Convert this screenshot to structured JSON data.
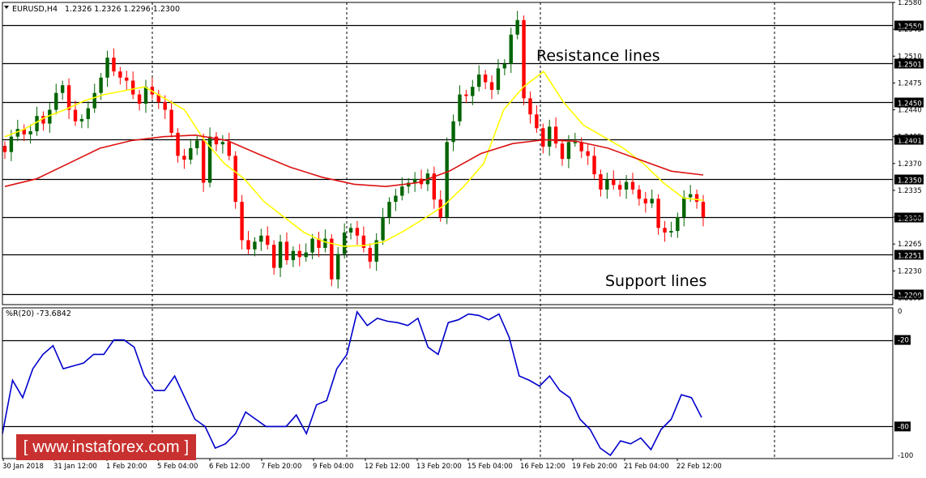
{
  "header": {
    "symbol": "EURUSD,H4",
    "ohlc": "1.2326 1.2326 1.2296 1.2300",
    "indicator": "%R(20) -73.6842"
  },
  "annotations": {
    "resistance": "Resistance lines",
    "support": "Support lines"
  },
  "watermark": "[ www.instaforex.com ]",
  "colors": {
    "bull": "#006400",
    "bear": "#ff0000",
    "ma_fast": "#ffff00",
    "ma_slow": "#dd1111",
    "wpr": "#0000cc",
    "watermark_bg": "#c8312f"
  },
  "chart_data": [
    {
      "type": "candlestick",
      "title": "EURUSD,H4",
      "ylim": [
        1.2186,
        1.258
      ],
      "y_ticks": [
        "1.2580",
        "1.2545",
        "1.2510",
        "1.2475",
        "1.2440",
        "1.2405",
        "1.2370",
        "1.2335",
        "1.2300",
        "1.2265",
        "1.2230",
        "1.2195"
      ],
      "levels": [
        {
          "label": "1.2550",
          "role": "resistance"
        },
        {
          "label": "1.2501",
          "role": "resistance"
        },
        {
          "label": "1.2450",
          "role": "resistance"
        },
        {
          "label": "1.2401",
          "role": "resistance"
        },
        {
          "label": "1.2350",
          "role": "resistance"
        },
        {
          "label": "1.2300",
          "role": "support"
        },
        {
          "label": "1.2251",
          "role": "support"
        },
        {
          "label": "1.2200",
          "role": "support"
        }
      ],
      "x_labels": [
        "30 Jan 2018",
        "31 Jan 12:00",
        "1 Feb 20:00",
        "5 Feb 04:00",
        "6 Feb 12:00",
        "7 Feb 20:00",
        "9 Feb 04:00",
        "12 Feb 12:00",
        "13 Feb 20:00",
        "15 Feb 04:00",
        "16 Feb 12:00",
        "19 Feb 20:00",
        "21 Feb 04:00",
        "22 Feb 12:00"
      ],
      "close": [
        1.2385,
        1.2405,
        1.2415,
        1.2408,
        1.2412,
        1.2432,
        1.2422,
        1.244,
        1.2462,
        1.2472,
        1.244,
        1.2425,
        1.2428,
        1.2442,
        1.2462,
        1.2482,
        1.2508,
        1.249,
        1.2482,
        1.2478,
        1.246,
        1.2448,
        1.247,
        1.246,
        1.245,
        1.244,
        1.241,
        1.238,
        1.2375,
        1.239,
        1.24,
        1.2345,
        1.2405,
        1.2395,
        1.2398,
        1.238,
        1.232,
        1.227,
        1.2258,
        1.2268,
        1.2276,
        1.2264,
        1.2234,
        1.2268,
        1.2244,
        1.2256,
        1.2248,
        1.2254,
        1.2272,
        1.226,
        1.2272,
        1.2219,
        1.2252,
        1.228,
        1.2286,
        1.2276,
        1.226,
        1.2242,
        1.227,
        1.23,
        1.232,
        1.2328,
        1.234,
        1.2345,
        1.235,
        1.2343,
        1.2357,
        1.2323,
        1.23,
        1.2398,
        1.2425,
        1.246,
        1.2458,
        1.247,
        1.2486,
        1.2476,
        1.2466,
        1.2494,
        1.25,
        1.2538,
        1.2557,
        1.2455,
        1.2434,
        1.2416,
        1.2392,
        1.2418,
        1.2396,
        1.2376,
        1.2398,
        1.2398,
        1.2386,
        1.238,
        1.2356,
        1.2336,
        1.2349,
        1.2342,
        1.2336,
        1.2346,
        1.2336,
        1.2324,
        1.2318,
        1.2324,
        1.2286,
        1.228,
        1.2282,
        1.23,
        1.2326,
        1.233,
        1.232,
        1.23
      ],
      "series": [
        {
          "name": "",
          "kind": "moving-average-fast",
          "values": [
            1.2405,
            1.2415,
            1.243,
            1.244,
            1.2452,
            1.246,
            1.2465,
            1.247,
            1.2455,
            1.244,
            1.24,
            1.237,
            1.235,
            1.232,
            1.23,
            1.228,
            1.2268,
            1.2262,
            1.2263,
            1.2268,
            1.2282,
            1.2298,
            1.2315,
            1.234,
            1.237,
            1.244,
            1.247,
            1.249,
            1.245,
            1.242,
            1.2405,
            1.239,
            1.237,
            1.2345,
            1.2325,
            1.2322
          ]
        },
        {
          "name": "",
          "kind": "moving-average-slow",
          "values": [
            1.234,
            1.235,
            1.237,
            1.239,
            1.24,
            1.2405,
            1.2407,
            1.24,
            1.2382,
            1.2365,
            1.2352,
            1.2343,
            1.234,
            1.2345,
            1.236,
            1.2383,
            1.2396,
            1.2401,
            1.2399,
            1.239,
            1.2375,
            1.236,
            1.2355
          ]
        }
      ]
    },
    {
      "type": "line",
      "title": "%R(20) -73.6842",
      "ylim": [
        -100,
        0
      ],
      "y_ticks": [
        "0",
        "-20",
        "-80",
        "-100"
      ],
      "levels": [
        -20,
        -80
      ],
      "series": [
        {
          "name": "",
          "kind": "williams-r",
          "values": [
            -85,
            -48,
            -60,
            -40,
            -30,
            -24,
            -40,
            -38,
            -36,
            -30,
            -30,
            -20,
            -20,
            -25,
            -45,
            -55,
            -55,
            -45,
            -60,
            -75,
            -80,
            -95,
            -92,
            -85,
            -70,
            -75,
            -80,
            -80,
            -80,
            -72,
            -85,
            -65,
            -62,
            -40,
            -30,
            -0.5,
            -10,
            -5,
            -7,
            -8,
            -10,
            -5,
            -25,
            -30,
            -8,
            -6,
            -2,
            -3,
            -6,
            -2,
            -18,
            -45,
            -48,
            -52,
            -45,
            -55,
            -60,
            -75,
            -82,
            -95,
            -100,
            -90,
            -92,
            -88,
            -96,
            -82,
            -75,
            -58,
            -60,
            -73.7
          ]
        }
      ]
    }
  ]
}
